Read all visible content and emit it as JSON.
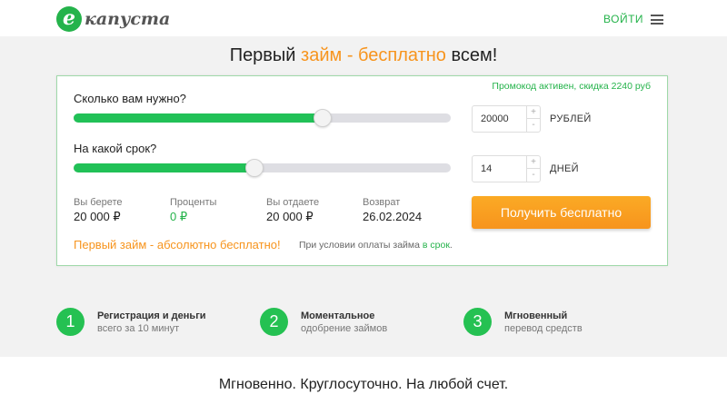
{
  "header": {
    "logo_letter": "е",
    "logo_text": "капуста",
    "login_label": "ВОЙТИ",
    "menu_icon": "hamburger-menu-icon"
  },
  "headline": {
    "part1": "Первый ",
    "accent": "займ - бесплатно",
    "part2": " всем!"
  },
  "calculator": {
    "promo": "Промокод активен, скидка 2240 руб",
    "amount": {
      "question": "Сколько вам нужно?",
      "value": "20000",
      "unit": "РУБЛЕЙ",
      "slider_fraction": 0.66
    },
    "term": {
      "question": "На какой срок?",
      "value": "14",
      "unit": "ДНЕЙ",
      "slider_fraction": 0.48
    },
    "stepper": {
      "plus": "+",
      "minus": "-"
    },
    "stats": [
      {
        "label": "Вы берете",
        "value": "20 000 ₽"
      },
      {
        "label": "Проценты",
        "value": "0 ₽"
      },
      {
        "label": "Вы отдаете",
        "value": "20 000 ₽"
      },
      {
        "label": "Возврат",
        "value": "26.02.2024"
      }
    ],
    "cta_label": "Получить бесплатно",
    "free_text": "Первый займ - абсолютно бесплатно!",
    "condition_text": "При условии оплаты займа ",
    "condition_link": "в срок",
    "condition_end": "."
  },
  "features": [
    {
      "number": "1",
      "title": "Регистрация и деньги",
      "subtitle": "всего за 10 минут"
    },
    {
      "number": "2",
      "title": "Моментальное",
      "subtitle": "одобрение займов"
    },
    {
      "number": "3",
      "title": "Мгновенный",
      "subtitle": "перевод средств"
    }
  ],
  "bottom_text": "Мгновенно. Круглосуточно. На любой счет.",
  "colors": {
    "brand_green": "#25b34b",
    "accent_orange": "#f7941d"
  }
}
